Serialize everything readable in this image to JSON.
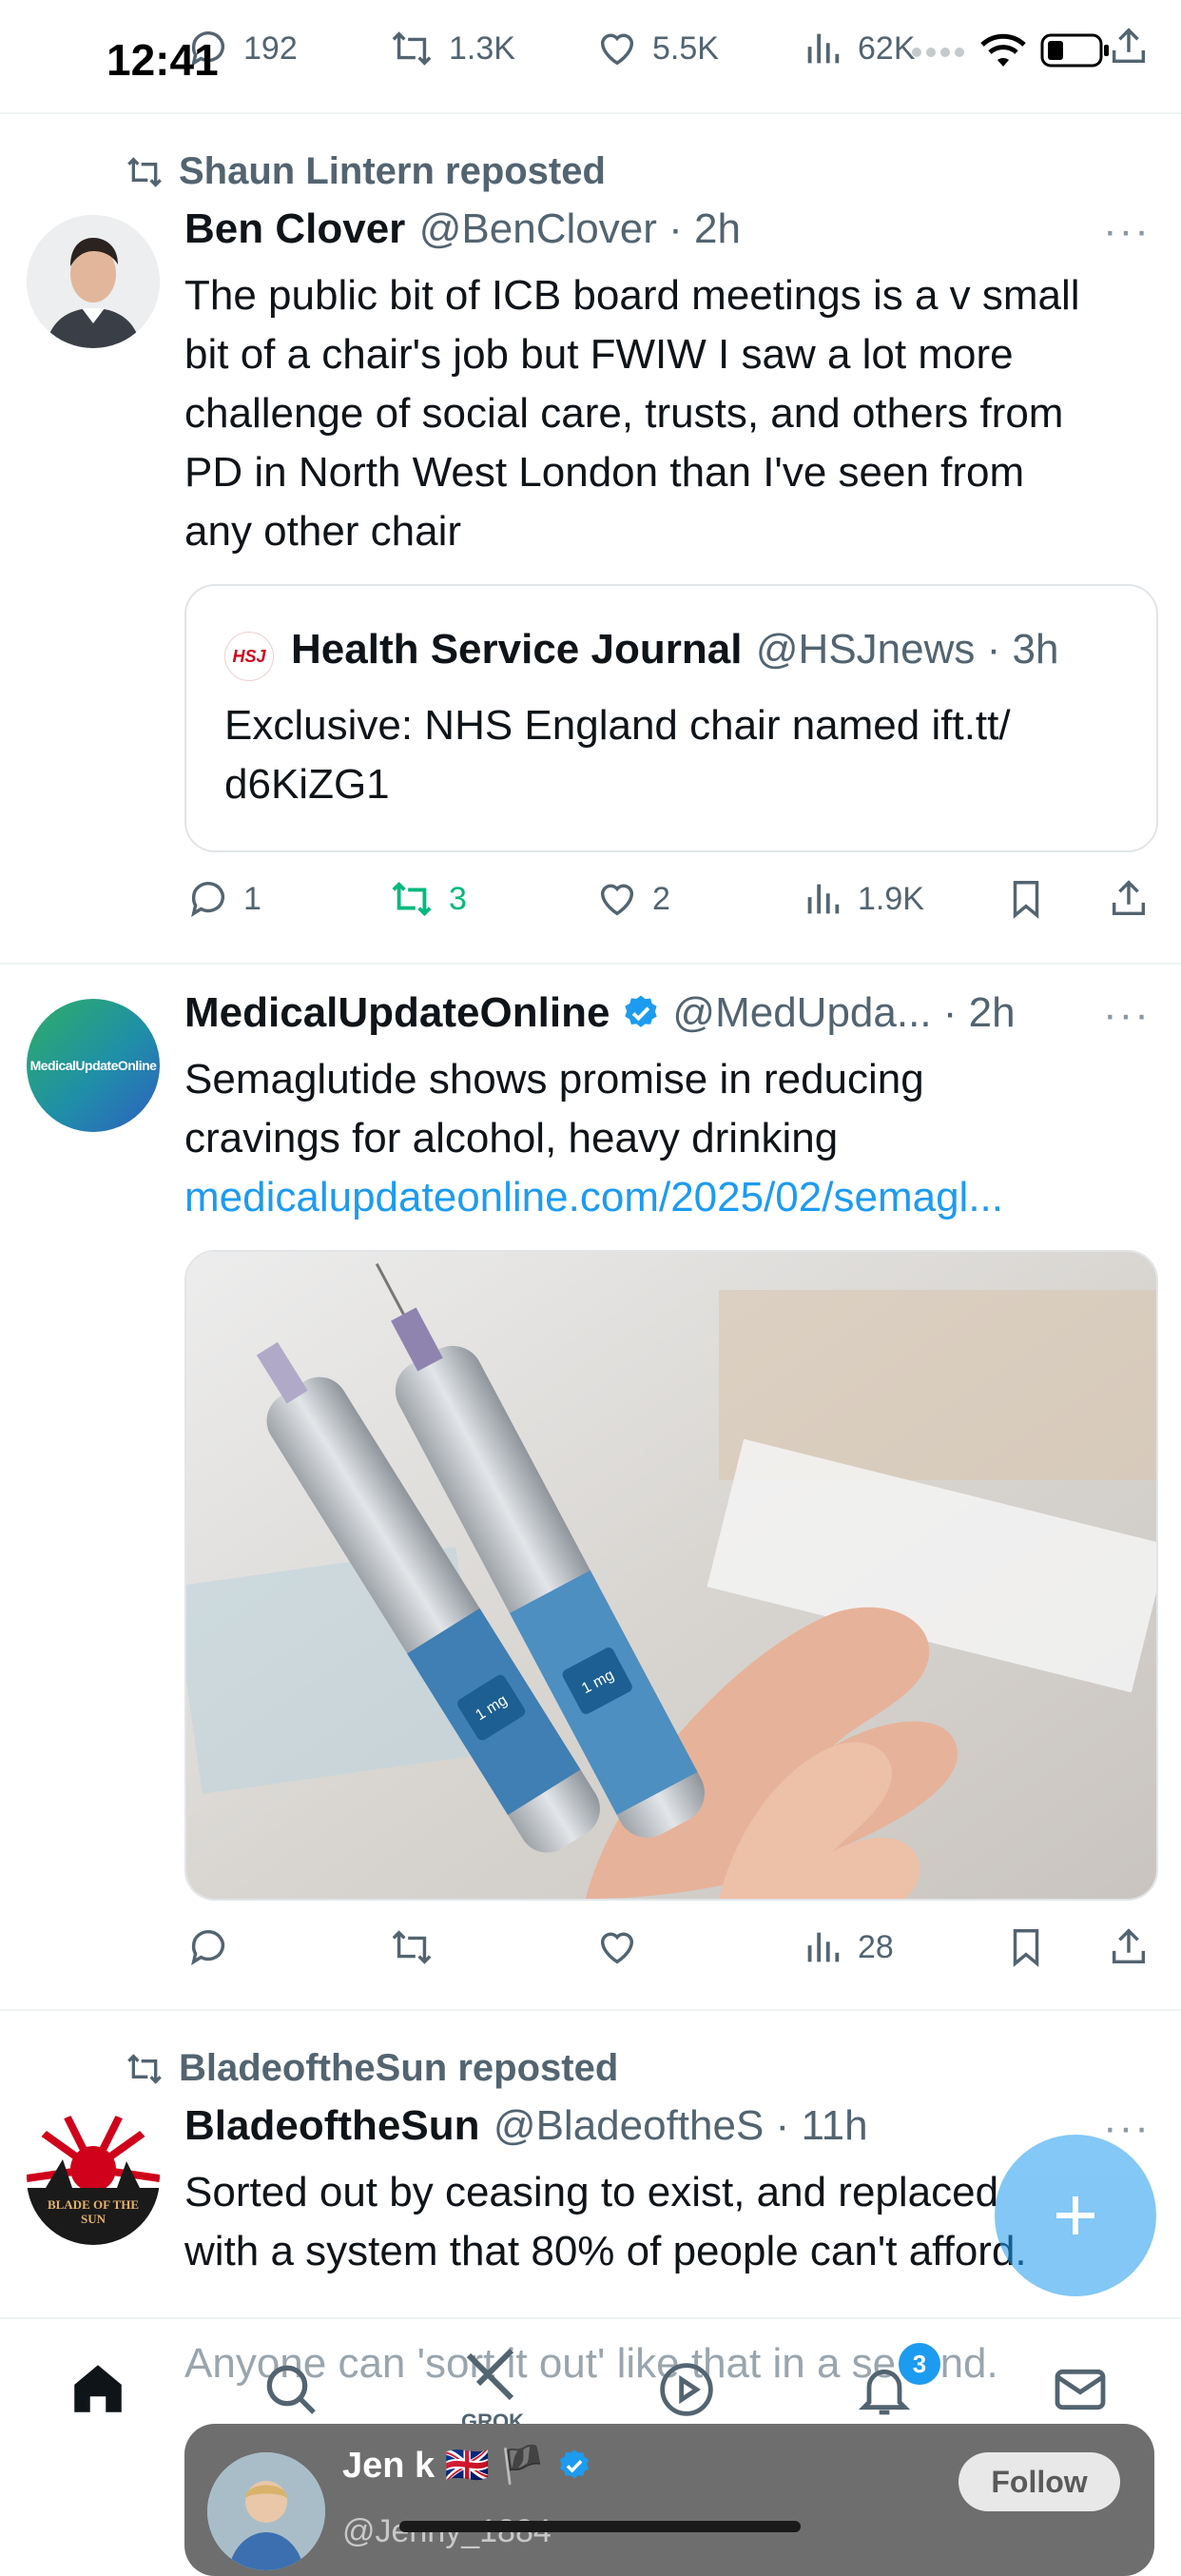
{
  "status_bar": {
    "time": "12:41"
  },
  "top_actions": {
    "replies": "192",
    "reposts": "1.3K",
    "likes": "5.5K",
    "views": "62K"
  },
  "posts": [
    {
      "repost_label": "Shaun Lintern reposted",
      "name": "Ben Clover",
      "handle": "@BenClover",
      "time": "2h",
      "lines": [
        "The public bit of ICB board meetings is a v small",
        "bit of a chair's job but FWIW I saw a lot more",
        "challenge of social care, trusts, and others from",
        "PD in North West London than I've seen from",
        "any other chair"
      ],
      "quote": {
        "logo_text": "HSJ",
        "name": "Health Service Journal",
        "handle": "@HSJnews",
        "time": "3h",
        "lines": [
          "Exclusive: NHS England chair named ift.tt/",
          "d6KiZG1"
        ]
      },
      "actions": {
        "replies": "1",
        "reposts": "3",
        "likes": "2",
        "views": "1.9K"
      }
    },
    {
      "name": "MedicalUpdateOnline",
      "handle": "@MedUpda...",
      "time": "2h",
      "avatar_text": "MedicalUpdateOnline",
      "lines": [
        "Semaglutide shows promise in reducing",
        "cravings for alcohol, heavy drinking"
      ],
      "link": "medicalupdateonline.com/2025/02/semagl...",
      "image_labels": [
        "1 mg",
        "1 mg"
      ],
      "actions": {
        "views": "28"
      }
    },
    {
      "repost_label": "BladeoftheSun reposted",
      "name": "BladeoftheSun",
      "handle": "@BladeoftheS",
      "time": "11h",
      "avatar_text": "BLADE OF THE SUN",
      "lines": [
        "Sorted out by ceasing to exist, and replaced",
        "with a system that 80% of people can't afford.",
        "Anyone can 'sort it out' like that in a second."
      ]
    }
  ],
  "suggestion": {
    "name": "Jen k 🇬🇧 🏴",
    "handle": "@Jenny_1884",
    "follow_label": "Follow"
  },
  "bottom_nav": {
    "grok_label": "GROK",
    "notifications_badge": "3"
  },
  "colors": {
    "accent": "#1d9bf0",
    "repost_green": "#00ba7c",
    "muted": "#536471"
  }
}
